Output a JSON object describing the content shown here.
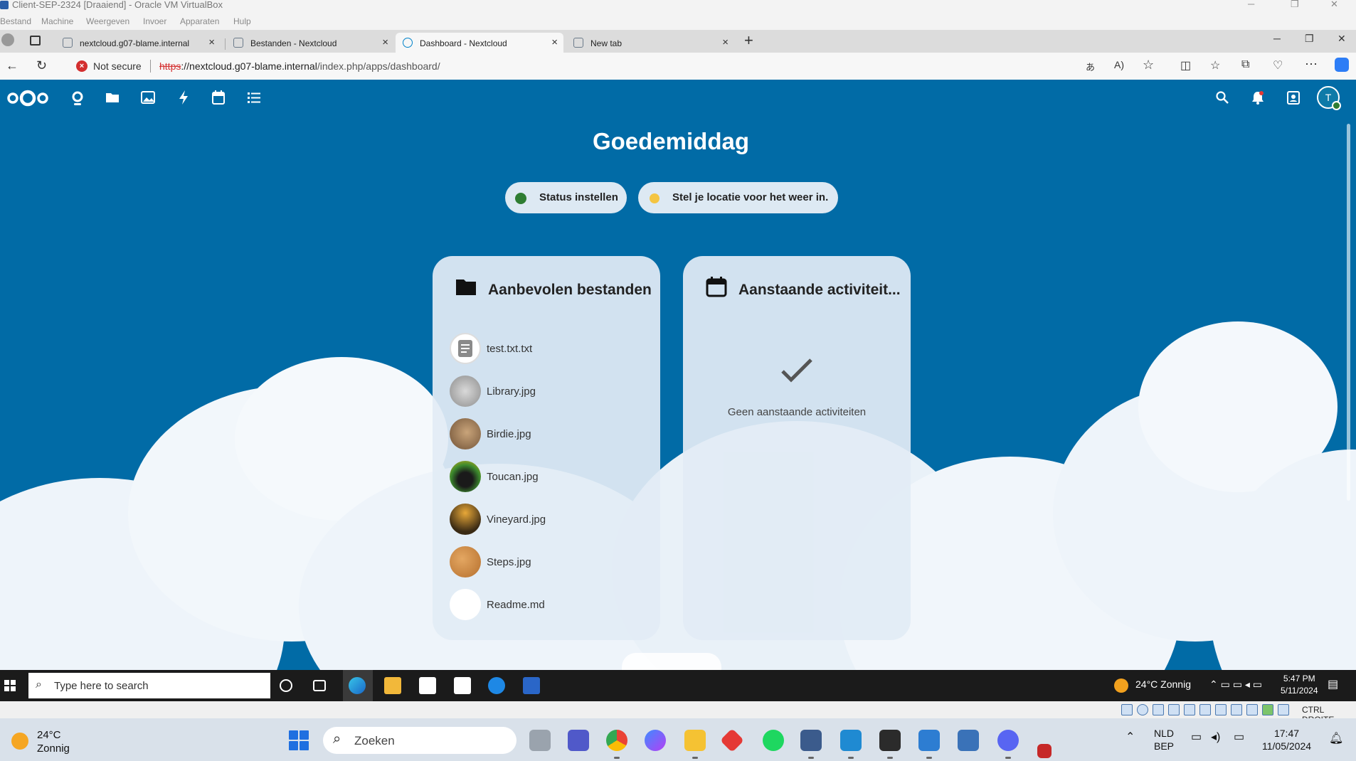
{
  "host_window": {
    "title": "Client-SEP-2324 [Draaiend] - Oracle VM VirtualBox",
    "menu": [
      "Bestand",
      "Machine",
      "Weergeven",
      "Invoer",
      "Apparaten",
      "Hulp"
    ]
  },
  "browser": {
    "tabs": [
      {
        "label": "nextcloud.g07-blame.internal",
        "active": false
      },
      {
        "label": "Bestanden - Nextcloud",
        "active": false
      },
      {
        "label": "Dashboard - Nextcloud",
        "active": true
      },
      {
        "label": "New tab",
        "active": false
      }
    ],
    "security_label": "Not secure",
    "url_protocol": "https",
    "url_host": "://nextcloud.g07-blame.internal",
    "url_path": "/index.php/apps/dashboard/"
  },
  "nextcloud": {
    "greeting": "Goedemiddag",
    "status_button": "Status instellen",
    "weather_button": "Stel je locatie voor het weer in.",
    "user_initial": "T",
    "recommended": {
      "title": "Aanbevolen bestanden",
      "files": [
        "test.txt.txt",
        "Library.jpg",
        "Birdie.jpg",
        "Toucan.jpg",
        "Vineyard.jpg",
        "Steps.jpg",
        "Readme.md"
      ]
    },
    "upcoming": {
      "title": "Aanstaande activiteit...",
      "empty": "Geen aanstaande activiteiten"
    }
  },
  "guest_taskbar": {
    "search_placeholder": "Type here to search",
    "weather": "24°C  Zonnig",
    "time": "5:47 PM",
    "date": "5/11/2024"
  },
  "vbox_status": {
    "host_key": "CTRL DROITE"
  },
  "host_taskbar": {
    "weather_temp": "24°C",
    "weather_desc": "Zonnig",
    "search_placeholder": "Zoeken",
    "lang": "NLD",
    "layout": "BEP",
    "time": "17:47",
    "date": "11/05/2024"
  },
  "colors": {
    "nextcloud_blue": "#016ba6",
    "status_online": "#2e7d32"
  }
}
